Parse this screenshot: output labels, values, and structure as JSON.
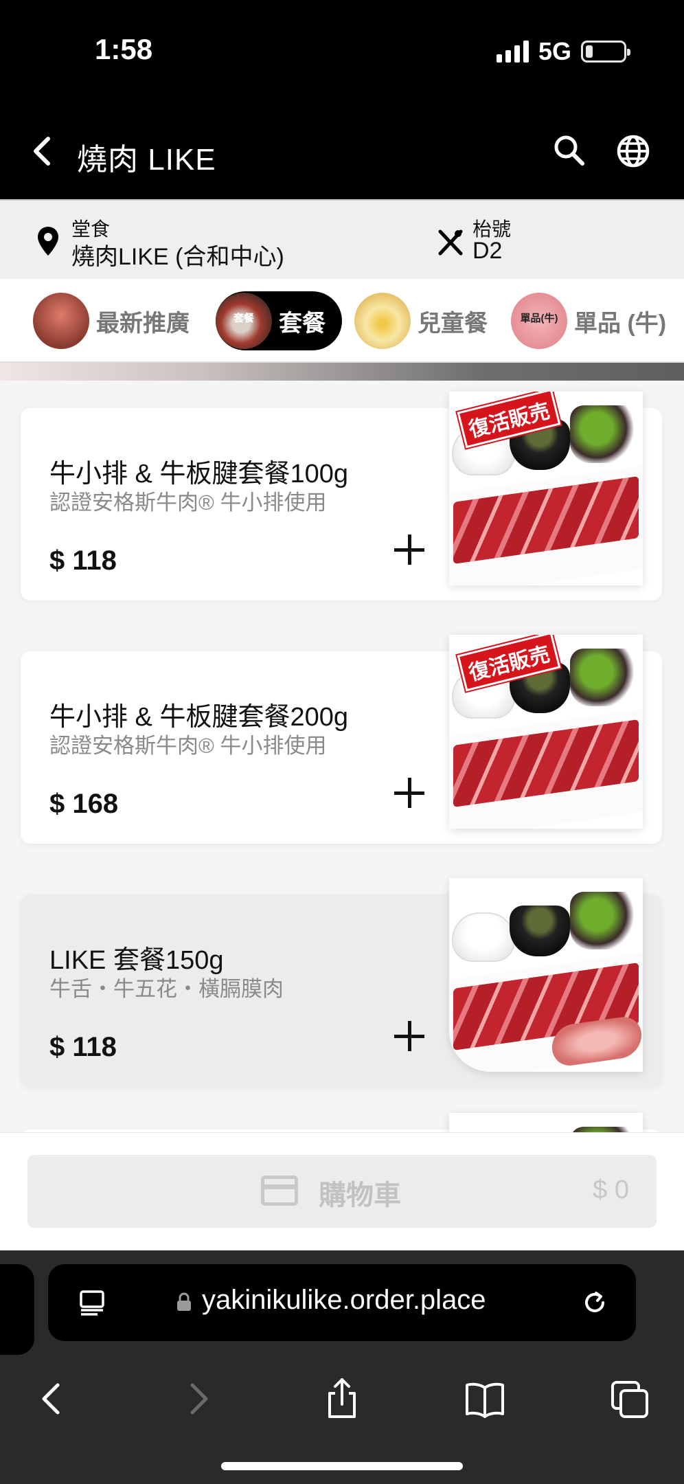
{
  "status_bar": {
    "time": "1:58",
    "network": "5G"
  },
  "header": {
    "title": "燒肉 LIKE"
  },
  "info": {
    "dine_type": "堂食",
    "store": "燒肉LIKE (合和中心)",
    "table_label": "枱號",
    "table_no": "D2"
  },
  "categories": [
    {
      "label": "最新推廣",
      "active": false,
      "thumb_text": ""
    },
    {
      "label": "套餐",
      "active": true,
      "thumb_text": "套餐"
    },
    {
      "label": "兒童餐",
      "active": false,
      "thumb_text": ""
    },
    {
      "label": "單品 (牛)",
      "active": false,
      "thumb_text": "單品(牛)"
    }
  ],
  "menu": [
    {
      "name": "牛小排 & 牛板腱套餐100g",
      "desc": "認證安格斯牛肉® 牛小排使用",
      "price": "$ 118",
      "badge": "復活販売"
    },
    {
      "name": "牛小排 & 牛板腱套餐200g",
      "desc": "認證安格斯牛肉® 牛小排使用",
      "price": "$ 168",
      "badge": "復活販売"
    },
    {
      "name": "LIKE 套餐150g",
      "desc": "牛舌・牛五花・橫膈膜肉",
      "price": "$ 118",
      "badge": ""
    }
  ],
  "cart": {
    "label": "購物車",
    "total": "$ 0"
  },
  "browser": {
    "url": "yakinikulike.order.place"
  },
  "colors": {
    "header_bg": "#000000",
    "accent_red": "#d5141b",
    "cart_bg": "#ececec"
  }
}
